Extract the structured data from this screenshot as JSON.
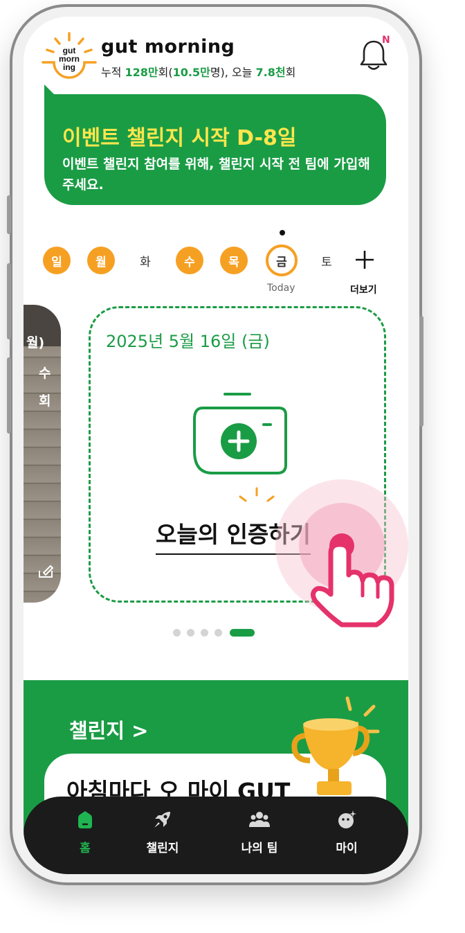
{
  "header": {
    "app_name": "gut morning",
    "logo_text": "gut morn ing",
    "stats": {
      "prefix": "누적 ",
      "total_count": "128만",
      "mid1": "회(",
      "people": "10.5만",
      "mid2": "명), 오늘 ",
      "today_count": "7.8천",
      "suffix": "회"
    },
    "notification_badge": "N"
  },
  "banner": {
    "title": "이벤트 챌린지 시작 D-8일",
    "description": "이벤트 챌린지 참여를 위해, 챌린지 시작 전 팀에 가입해 주세요."
  },
  "week": {
    "days": [
      {
        "label": "일",
        "state": "done"
      },
      {
        "label": "월",
        "state": "done"
      },
      {
        "label": "화",
        "state": "none"
      },
      {
        "label": "수",
        "state": "done"
      },
      {
        "label": "목",
        "state": "done"
      },
      {
        "label": "금",
        "state": "today"
      },
      {
        "label": "토",
        "state": "none"
      }
    ],
    "today_label": "Today",
    "more_label": "더보기"
  },
  "side_card": {
    "line1": "월)",
    "line2": "수",
    "line3": "회"
  },
  "main_card": {
    "date": "2025년 5월 16일 (금)",
    "action_label": "오늘의 인증하기"
  },
  "pager": {
    "count": 5,
    "active_index": 4
  },
  "challenge": {
    "title": "챌린지 >",
    "card_text": "아침마다 오 마이 GUT"
  },
  "nav": {
    "items": [
      {
        "label": "홈",
        "icon": "home-icon",
        "active": true
      },
      {
        "label": "챌린지",
        "icon": "rocket-icon",
        "active": false
      },
      {
        "label": "나의 팀",
        "icon": "team-icon",
        "active": false
      },
      {
        "label": "마이",
        "icon": "profile-icon",
        "active": false
      }
    ]
  },
  "colors": {
    "brand_green": "#1a9c45",
    "accent_orange": "#f6a023",
    "banner_title_yellow": "#ffe64d",
    "touch_pink": "#e5326b",
    "nav_bg": "#1b1b1b"
  }
}
